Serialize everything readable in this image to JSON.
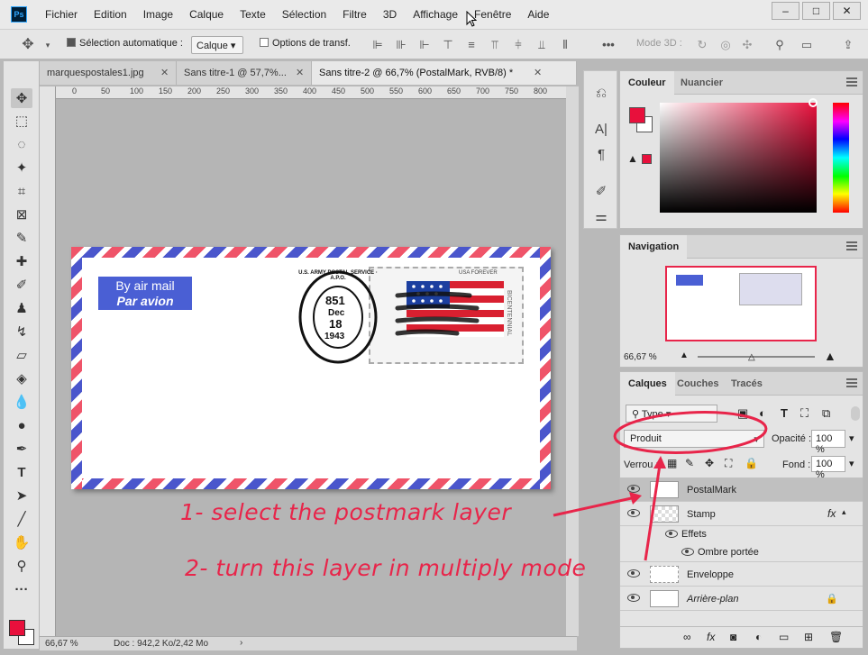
{
  "menu": [
    "Fichier",
    "Edition",
    "Image",
    "Calque",
    "Texte",
    "Sélection",
    "Filtre",
    "3D",
    "Affichage",
    "Fenêtre",
    "Aide"
  ],
  "app_logo": "Ps",
  "options": {
    "auto_select_label": "Sélection automatique :",
    "auto_select_value": "Calque",
    "transform_label": "Options de transf.",
    "mode3d_label": "Mode 3D :"
  },
  "tabs": [
    {
      "label": "marquespostales1.jpg"
    },
    {
      "label": "Sans titre-1 @ 57,7%..."
    },
    {
      "label": "Sans titre-2 @ 66,7% (PostalMark, RVB/8) *"
    }
  ],
  "ruler_marks": [
    "0",
    "50",
    "100",
    "150",
    "200",
    "250",
    "300",
    "350",
    "400",
    "450",
    "500",
    "550",
    "600",
    "650",
    "700",
    "750",
    "800"
  ],
  "envelope": {
    "label_line1": "By air mail",
    "label_line2": "Par avion",
    "stamp_text_top": "USA FOREVER",
    "stamp_text_side": "BICENTENNIAL",
    "postmark_ring": "U.S. ARMY POSTAL SERVICE · A.P.O.",
    "postmark_line1": "851",
    "postmark_line2": "Dec",
    "postmark_line3": "18",
    "postmark_line4": "1943"
  },
  "status": {
    "zoom": "66,67 %",
    "doc": "Doc : 942,2 Ko/2,42 Mo"
  },
  "color_panel": {
    "tabs": [
      "Couleur",
      "Nuancier"
    ],
    "foreground": "#e8103c",
    "background": "#ffffff"
  },
  "navigation": {
    "tab": "Navigation",
    "zoom": "66,67 %"
  },
  "layers_panel": {
    "tabs": [
      "Calques",
      "Couches",
      "Tracés"
    ],
    "filter_label": "Type",
    "blend_mode": "Produit",
    "opacity_label": "Opacité :",
    "opacity_value": "100 %",
    "lock_label": "Verrou :",
    "fill_label": "Fond :",
    "fill_value": "100 %",
    "layers": [
      {
        "name": "PostalMark"
      },
      {
        "name": "Stamp",
        "fx": "fx"
      },
      {
        "name": "Effets"
      },
      {
        "name": "Ombre portée"
      },
      {
        "name": "Enveloppe"
      },
      {
        "name": "Arrière-plan"
      }
    ]
  },
  "annotations": {
    "step1": "1- select the postmark layer",
    "step2": "2- turn this layer in multiply mode"
  },
  "colors": {
    "accent": "#e8254a",
    "airmail_blue": "#4a5fd4",
    "airmail_red": "#ef5469"
  }
}
